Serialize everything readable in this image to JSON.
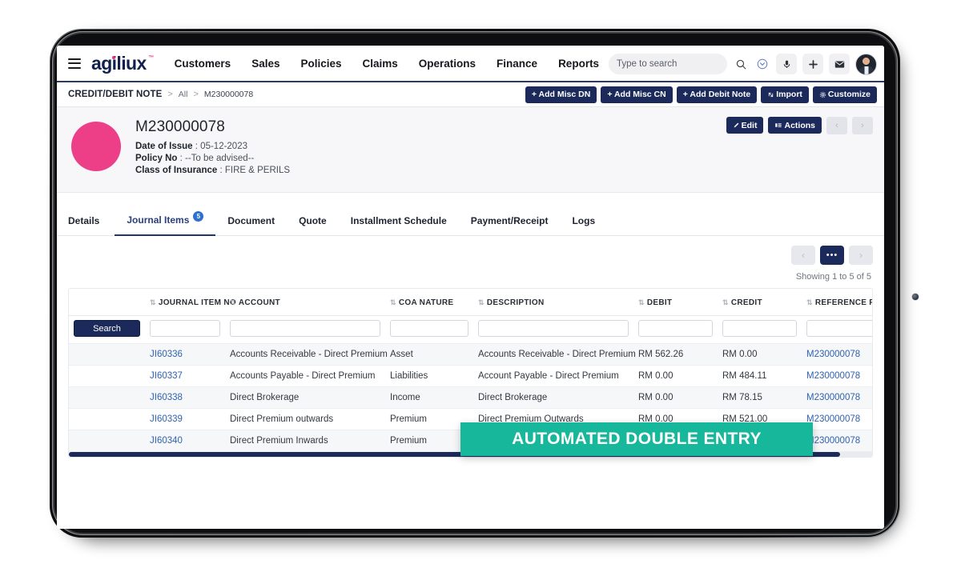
{
  "topnav": {
    "menu_icon": "hamburger-icon",
    "logo": "agiliux",
    "logo_tm": "™",
    "links": [
      "Customers",
      "Sales",
      "Policies",
      "Claims",
      "Operations",
      "Finance",
      "Reports"
    ],
    "search_placeholder": "Type to search",
    "search_value": "",
    "icons": [
      "search-icon",
      "chevron-down-circle-icon",
      "microphone-icon",
      "plus-icon",
      "envelope-icon",
      "avatar"
    ]
  },
  "breadcrumb": {
    "module": "CREDIT/DEBIT NOTE",
    "separator": ">",
    "all": "All",
    "current": "M230000078",
    "buttons": [
      {
        "label": "+ Add Misc DN",
        "icon": "plus-icon"
      },
      {
        "label": "+ Add Misc CN",
        "icon": "plus-icon"
      },
      {
        "label": "+ Add Debit Note",
        "icon": "plus-icon"
      },
      {
        "label": "Import",
        "icon": "import-icon"
      },
      {
        "label": "Customize",
        "icon": "gear-icon"
      }
    ]
  },
  "record": {
    "title": "M230000078",
    "date_label": "Date of Issue",
    "date_value": "05-12-2023",
    "policy_label": "Policy No",
    "policy_value": "--To be advised--",
    "class_label": "Class of Insurance",
    "class_value": "FIRE & PERILS",
    "edit_label": "Edit",
    "actions_label": "Actions",
    "prev_icon": "chevron-left-icon",
    "next_icon": "chevron-right-icon",
    "avatar_color": "#ec3f87"
  },
  "tabs": [
    {
      "label": "Details",
      "active": false,
      "badge": ""
    },
    {
      "label": "Journal Items",
      "active": true,
      "badge": "5"
    },
    {
      "label": "Document",
      "active": false,
      "badge": ""
    },
    {
      "label": "Quote",
      "active": false,
      "badge": ""
    },
    {
      "label": "Installment Schedule",
      "active": false,
      "badge": ""
    },
    {
      "label": "Payment/Receipt",
      "active": false,
      "badge": ""
    },
    {
      "label": "Logs",
      "active": false,
      "badge": ""
    }
  ],
  "pager": {
    "prev_icon": "chevron-left-icon",
    "more_label": "•••",
    "next_icon": "chevron-right-icon",
    "showing": "Showing 1 to 5 of 5"
  },
  "table": {
    "search_button": "Search",
    "columns": [
      "JOURNAL ITEM NO",
      "ACCOUNT",
      "COA NATURE",
      "DESCRIPTION",
      "DEBIT",
      "CREDIT",
      "REFERENCE R"
    ],
    "filter_values": [
      "",
      "",
      "",
      "",
      "",
      "",
      ""
    ],
    "rows": [
      {
        "journal_item_no": "JI60336",
        "account": "Accounts Receivable - Direct Premium",
        "coa_nature": "Asset",
        "description": "Accounts Receivable - Direct Premium",
        "debit": "RM 562.26",
        "credit": "RM 0.00",
        "reference": "M230000078"
      },
      {
        "journal_item_no": "JI60337",
        "account": "Accounts Payable - Direct Premium",
        "coa_nature": "Liabilities",
        "description": "Account Payable - Direct Premium",
        "debit": "RM 0.00",
        "credit": "RM 484.11",
        "reference": "M230000078"
      },
      {
        "journal_item_no": "JI60338",
        "account": "Direct Brokerage",
        "coa_nature": "Income",
        "description": "Direct Brokerage",
        "debit": "RM 0.00",
        "credit": "RM 78.15",
        "reference": "M230000078"
      },
      {
        "journal_item_no": "JI60339",
        "account": "Direct Premium outwards",
        "coa_nature": "Premium",
        "description": "Direct Premium Outwards",
        "debit": "RM 0.00",
        "credit": "RM 521.00",
        "reference": "M230000078"
      },
      {
        "journal_item_no": "JI60340",
        "account": "Direct Premium Inwards",
        "coa_nature": "Premium",
        "description": "",
        "debit": "",
        "credit": "",
        "reference": "M230000078"
      }
    ]
  },
  "banner": {
    "text": "AUTOMATED DOUBLE ENTRY",
    "color": "#16b79a"
  }
}
